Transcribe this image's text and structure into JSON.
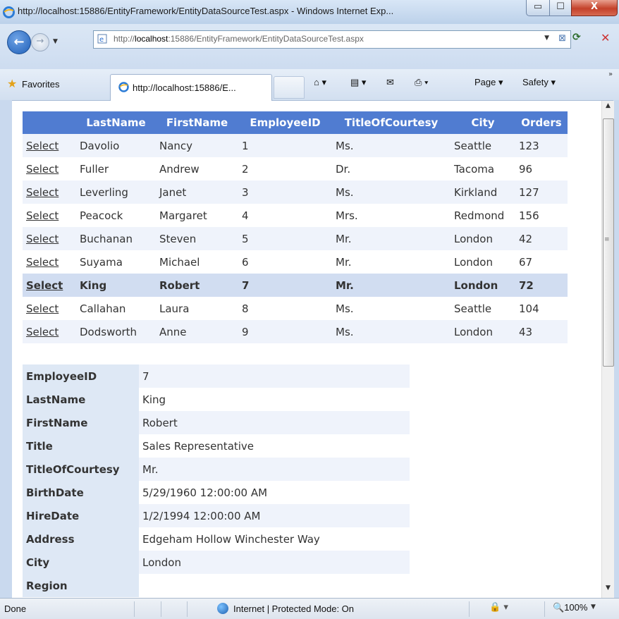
{
  "window": {
    "title": "http://localhost:15886/EntityFramework/EntityDataSourceTest.aspx - Windows Internet Exp...",
    "minimize": "▭",
    "maximize": "☐",
    "close": "X"
  },
  "address_bar": {
    "url_prefix": "http://",
    "url_host": "localhost",
    "url_rest": ":15886/EntityFramework/EntityDataSourceTest.aspx"
  },
  "favorites_bar": {
    "favorites_label": "Favorites",
    "tab_label": "http://localhost:15886/E...",
    "commands": {
      "page": "Page ▾",
      "safety": "Safety ▾"
    }
  },
  "grid": {
    "headers": [
      "",
      "LastName",
      "FirstName",
      "EmployeeID",
      "TitleOfCourtesy",
      "City",
      "Orders"
    ],
    "select_label": "Select",
    "selected_index": 6,
    "rows": [
      {
        "last": "Davolio",
        "first": "Nancy",
        "id": "1",
        "toc": "Ms.",
        "city": "Seattle",
        "orders": "123"
      },
      {
        "last": "Fuller",
        "first": "Andrew",
        "id": "2",
        "toc": "Dr.",
        "city": "Tacoma",
        "orders": "96"
      },
      {
        "last": "Leverling",
        "first": "Janet",
        "id": "3",
        "toc": "Ms.",
        "city": "Kirkland",
        "orders": "127"
      },
      {
        "last": "Peacock",
        "first": "Margaret",
        "id": "4",
        "toc": "Mrs.",
        "city": "Redmond",
        "orders": "156"
      },
      {
        "last": "Buchanan",
        "first": "Steven",
        "id": "5",
        "toc": "Mr.",
        "city": "London",
        "orders": "42"
      },
      {
        "last": "Suyama",
        "first": "Michael",
        "id": "6",
        "toc": "Mr.",
        "city": "London",
        "orders": "67"
      },
      {
        "last": "King",
        "first": "Robert",
        "id": "7",
        "toc": "Mr.",
        "city": "London",
        "orders": "72"
      },
      {
        "last": "Callahan",
        "first": "Laura",
        "id": "8",
        "toc": "Ms.",
        "city": "Seattle",
        "orders": "104"
      },
      {
        "last": "Dodsworth",
        "first": "Anne",
        "id": "9",
        "toc": "Ms.",
        "city": "London",
        "orders": "43"
      }
    ]
  },
  "details": [
    {
      "field": "EmployeeID",
      "value": "7"
    },
    {
      "field": "LastName",
      "value": "King"
    },
    {
      "field": "FirstName",
      "value": "Robert"
    },
    {
      "field": "Title",
      "value": "Sales Representative"
    },
    {
      "field": "TitleOfCourtesy",
      "value": "Mr."
    },
    {
      "field": "BirthDate",
      "value": "5/29/1960 12:00:00 AM"
    },
    {
      "field": "HireDate",
      "value": "1/2/1994 12:00:00 AM"
    },
    {
      "field": "Address",
      "value": "Edgeham Hollow Winchester Way"
    },
    {
      "field": "City",
      "value": "London"
    },
    {
      "field": "Region",
      "value": ""
    }
  ],
  "status_bar": {
    "status": "Done",
    "zone": "Internet | Protected Mode: On",
    "zoom": "100%"
  },
  "colors": {
    "grid_header": "#507cd1",
    "grid_alt_row": "#eff3fb",
    "grid_selected_row": "#d1ddf1",
    "detail_header": "#dee8f5"
  }
}
